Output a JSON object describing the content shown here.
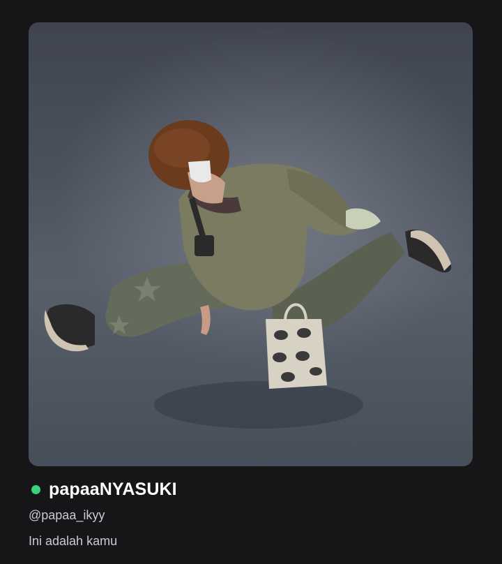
{
  "profile": {
    "display_name": "papaaNYASUKI",
    "username": "@papaa_ikyy",
    "bio": "Ini adalah kamu",
    "presence_status_color": "#3fd17a"
  },
  "avatar": {
    "icon": "avatar-3d-render"
  }
}
